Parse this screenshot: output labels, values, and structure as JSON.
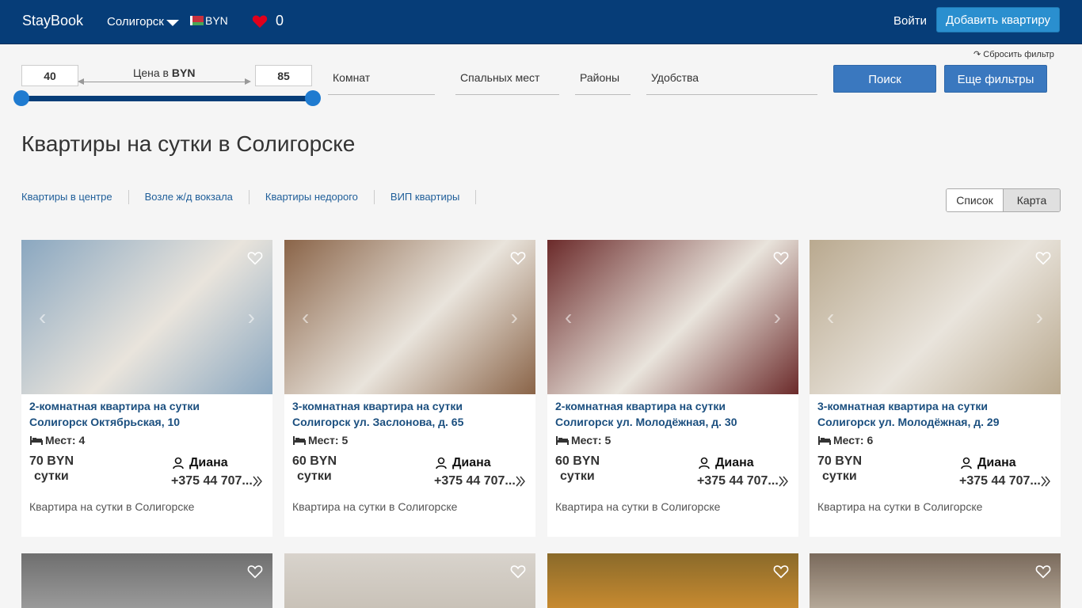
{
  "header": {
    "logo": "StayBook",
    "city": "Солигорск",
    "currency": "BYN",
    "favorites_count": "0",
    "login": "Войти",
    "add_button": "Добавить квартиру"
  },
  "filters": {
    "reset": "↷ Сбросить фильтр",
    "price_min": "40",
    "price_max": "85",
    "price_label_prefix": "Цена в ",
    "price_label_currency": "BYN",
    "price_slider_min_pct": 0,
    "price_slider_max_pct": 100,
    "rooms": "Комнат",
    "beds": "Спальных мест",
    "districts": "Районы",
    "amenities": "Удобства",
    "search": "Поиск",
    "more_filters": "Еще фильтры"
  },
  "page_title": "Квартиры на сутки в Солигорске",
  "quick_links": [
    "Квартиры в центре",
    "Возле ж/д вокзала",
    "Квартиры недорого",
    "ВИП квартиры"
  ],
  "view_toggle": {
    "list": "Список",
    "map": "Карта"
  },
  "listings": [
    {
      "title_line1": "2-комнатная квартира на сутки",
      "title_line2": "Солигорск Октябрьская, 10",
      "places": "Мест: 4",
      "price": "70 BYN",
      "per": "сутки",
      "owner": "Диана",
      "phone": "+375 44 707...",
      "desc": "Квартира на сутки в Солигорске",
      "img_color": "#8aa7c0"
    },
    {
      "title_line1": "3-комнатная квартира на сутки",
      "title_line2": "Солигорск ул. Заслонова, д. 65",
      "places": "Мест: 5",
      "price": "60 BYN",
      "per": "сутки",
      "owner": "Диана",
      "phone": "+375 44 707...",
      "desc": "Квартира на сутки в Солигорске",
      "img_color": "#8a6448"
    },
    {
      "title_line1": "2-комнатная квартира на сутки",
      "title_line2": "Солигорск ул. Молодёжная, д. 30",
      "places": "Мест: 5",
      "price": "60 BYN",
      "per": "сутки",
      "owner": "Диана",
      "phone": "+375 44 707...",
      "desc": "Квартира на сутки в Солигорске",
      "img_color": "#6b2a2a"
    },
    {
      "title_line1": "3-комнатная квартира на сутки",
      "title_line2": "Солигорск ул. Молодёжная, д. 29",
      "places": "Мест: 6",
      "price": "70 BYN",
      "per": "сутки",
      "owner": "Диана",
      "phone": "+375 44 707...",
      "desc": "Квартира на сутки в Солигорске",
      "img_color": "#b9a98f"
    }
  ],
  "colors": {
    "header_bg": "#063d78",
    "accent": "#2a8fcf",
    "button": "#3a78bf",
    "link": "#1f5e99"
  }
}
